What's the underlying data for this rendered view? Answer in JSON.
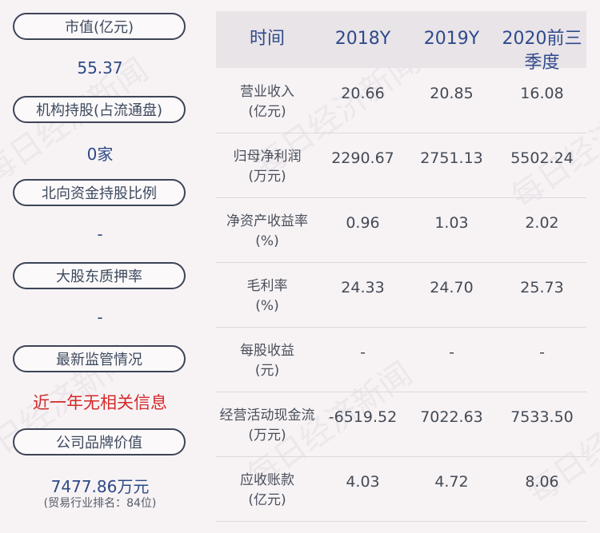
{
  "left": [
    {
      "label": "市值(亿元)",
      "value": "55.37"
    },
    {
      "label": "机构持股(占流通盘)",
      "value": "0家"
    },
    {
      "label": "北向资金持股比例",
      "value": "-"
    },
    {
      "label": "大股东质押率",
      "value": "-"
    },
    {
      "label": "最新监管情况",
      "value": "近一年无相关信息"
    },
    {
      "label": "公司品牌价值",
      "value": "7477.86万元",
      "sub": "(贸易行业排名：84位)"
    }
  ],
  "table": {
    "headers": [
      "时间",
      "2018Y",
      "2019Y",
      "2020前三季度"
    ],
    "rows": [
      {
        "label": "营业收入(亿元)",
        "values": [
          "20.66",
          "20.85",
          "16.08"
        ]
      },
      {
        "label": "归母净利润(万元)",
        "values": [
          "2290.67",
          "2751.13",
          "5502.24"
        ]
      },
      {
        "label": "净资产收益率(%)",
        "values": [
          "0.96",
          "1.03",
          "2.02"
        ]
      },
      {
        "label": "毛利率(%)",
        "values": [
          "24.33",
          "24.70",
          "25.73"
        ]
      },
      {
        "label": "每股收益(元)",
        "values": [
          "-",
          "-",
          "-"
        ]
      },
      {
        "label": "经营活动现金流(万元)",
        "values": [
          "-6519.52",
          "7022.63",
          "7533.50"
        ]
      },
      {
        "label": "应收账款(亿元)",
        "values": [
          "4.03",
          "4.72",
          "8.06"
        ]
      }
    ]
  },
  "watermark": "每日经济新闻",
  "colors": {
    "accent_blue": "#2d4a86",
    "alert_red": "#d42a2a",
    "header_bg": "#e8e4e7"
  }
}
